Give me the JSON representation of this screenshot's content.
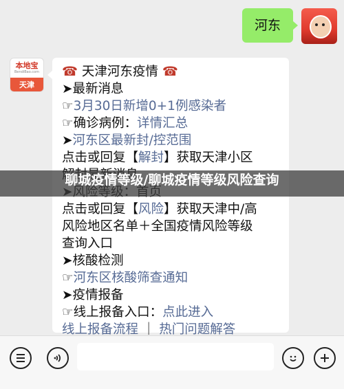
{
  "user_message": {
    "text": "河东"
  },
  "bot_avatar": {
    "brand": "本地宝",
    "brand_sub": "BendiBao.com",
    "city": "天津"
  },
  "bot_message": {
    "lines": [
      {
        "parts": [
          {
            "t": "☎",
            "c": "phone"
          },
          {
            "t": " 天津河东疫情 ",
            "c": ""
          },
          {
            "t": "☎",
            "c": "phone"
          }
        ]
      },
      {
        "parts": [
          {
            "t": "➤最新消息",
            "c": ""
          }
        ]
      },
      {
        "parts": [
          {
            "t": "☞",
            "c": ""
          },
          {
            "t": "3月30日新增0+1例感染者",
            "c": "link"
          }
        ]
      },
      {
        "parts": [
          {
            "t": "☞确诊病例：",
            "c": ""
          },
          {
            "t": "详情汇总",
            "c": "link"
          }
        ]
      },
      {
        "parts": [
          {
            "t": "➤",
            "c": ""
          },
          {
            "t": "河东区最新封/控范围",
            "c": "link"
          }
        ]
      },
      {
        "parts": [
          {
            "t": "点击或回复【",
            "c": ""
          },
          {
            "t": "解封",
            "c": "link"
          },
          {
            "t": "】获取天津小区",
            "c": ""
          }
        ]
      },
      {
        "parts": [
          {
            "t": "解封最新消息",
            "c": ""
          }
        ]
      },
      {
        "parts": [
          {
            "t": "➤风险等级：首页",
            "c": ""
          }
        ]
      },
      {
        "parts": [
          {
            "t": "点击或回复【",
            "c": ""
          },
          {
            "t": "风险",
            "c": "link"
          },
          {
            "t": "】获取天津中/高",
            "c": ""
          }
        ]
      },
      {
        "parts": [
          {
            "t": "风险地区名单＋全国疫情风险等级",
            "c": ""
          }
        ]
      },
      {
        "parts": [
          {
            "t": "查询入口",
            "c": ""
          }
        ]
      },
      {
        "parts": [
          {
            "t": "➤核酸检测",
            "c": ""
          }
        ]
      },
      {
        "parts": [
          {
            "t": "☞",
            "c": ""
          },
          {
            "t": "河东区核酸筛查通知",
            "c": "link"
          }
        ]
      },
      {
        "parts": [
          {
            "t": "➤疫情报备",
            "c": ""
          }
        ]
      },
      {
        "parts": [
          {
            "t": "☞线上报备入口：",
            "c": ""
          },
          {
            "t": "点此进入",
            "c": "link"
          }
        ]
      },
      {
        "parts": [
          {
            "t": "线上报备流程",
            "c": "link"
          },
          {
            "t": " ｜ ",
            "c": ""
          },
          {
            "t": "热门问题解答",
            "c": "link"
          }
        ]
      }
    ]
  },
  "watermark": {
    "text": "聊城疫情等级/聊城疫情等级风险查询"
  },
  "bottom_bar": {
    "menu_icon": "menu-list-icon",
    "voice_icon": "voice-icon",
    "emoji_icon": "emoji-icon",
    "add_icon": "plus-icon"
  },
  "colors": {
    "user_bubble": "#95ec69",
    "link": "#576b95",
    "brand": "#e8573a"
  }
}
